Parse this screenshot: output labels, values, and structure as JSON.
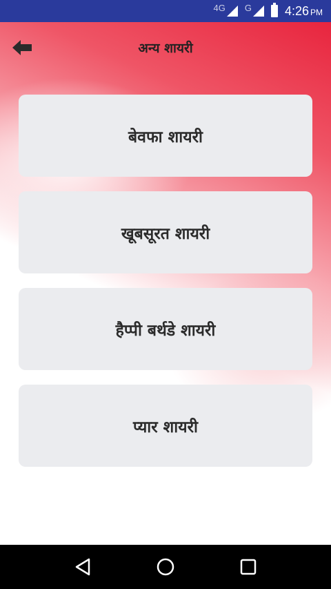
{
  "status_bar": {
    "network_primary": "4G",
    "network_secondary": "G",
    "time": "4:26",
    "ampm": "PM"
  },
  "toolbar": {
    "back_icon": "arrow-left-icon",
    "title": "अन्य शायरी"
  },
  "categories": [
    {
      "label": "बेवफा शायरी"
    },
    {
      "label": "खूबसूरत शायरी"
    },
    {
      "label": "हैप्पी बर्थडे शायरी"
    },
    {
      "label": "प्यार शायरी"
    }
  ],
  "nav_bar": {
    "back_icon": "triangle-back-icon",
    "home_icon": "circle-home-icon",
    "recents_icon": "square-recents-icon"
  },
  "colors": {
    "status_bar": "#2a3a9c",
    "accent_red": "#e8253e",
    "card_bg": "#ebecef",
    "nav_bar": "#000000"
  }
}
